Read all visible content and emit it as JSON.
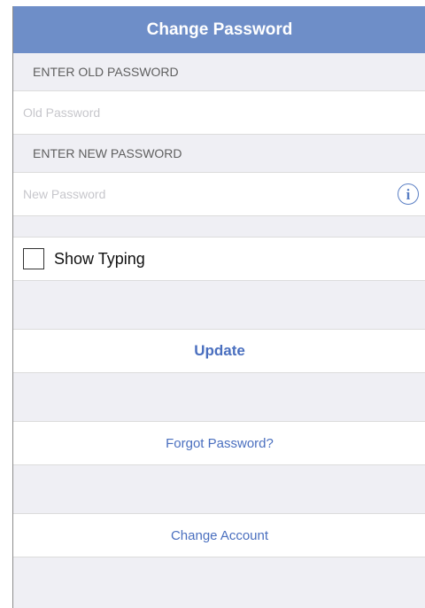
{
  "header": {
    "title": "Change Password"
  },
  "old_password": {
    "section_label": "ENTER OLD PASSWORD",
    "placeholder": "Old Password",
    "value": ""
  },
  "new_password": {
    "section_label": "ENTER NEW PASSWORD",
    "placeholder": "New Password",
    "value": "",
    "info_icon": "info-circle-icon",
    "info_glyph": "i"
  },
  "show_typing": {
    "label": "Show Typing",
    "checked": false
  },
  "actions": {
    "update_label": "Update",
    "forgot_label": "Forgot Password?",
    "change_account_label": "Change Account"
  },
  "colors": {
    "header_bg": "#6e8ec8",
    "accent": "#4a6fbf",
    "background": "#efeff4"
  }
}
